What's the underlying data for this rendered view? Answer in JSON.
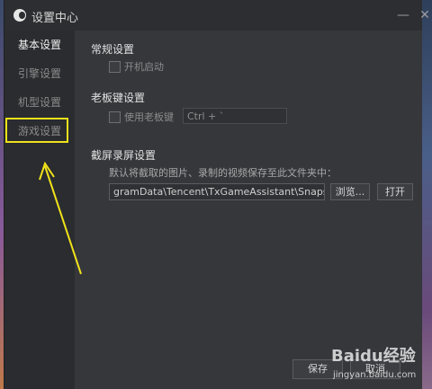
{
  "window": {
    "title": "设置中心",
    "minimize_symbol": "—",
    "close_symbol": "✕"
  },
  "sidebar": {
    "items": [
      {
        "label": "基本设置",
        "active": true
      },
      {
        "label": "引擎设置",
        "active": false
      },
      {
        "label": "机型设置",
        "active": false
      },
      {
        "label": "游戏设置",
        "active": false
      }
    ]
  },
  "general": {
    "title": "常规设置",
    "autostart_label": "开机启动",
    "autostart_checked": false
  },
  "boss_key": {
    "title": "老板键设置",
    "use_label": "使用老板键",
    "use_checked": false,
    "hotkey_value": "Ctrl + `"
  },
  "capture": {
    "title": "截屏录屏设置",
    "description": "默认将截取的图片、录制的视频保存至此文件夹中：",
    "path_value": "gramData\\Tencent\\TxGameAssistant\\Snapshot",
    "browse_label": "浏览...",
    "open_label": "打开"
  },
  "footer": {
    "save_label": "保存",
    "cancel_label": "取消"
  },
  "watermark": {
    "brand": "Baidu经验",
    "url": "jingyan.baidu.com"
  },
  "annotation": {
    "highlight_color": "#f1e21b"
  }
}
